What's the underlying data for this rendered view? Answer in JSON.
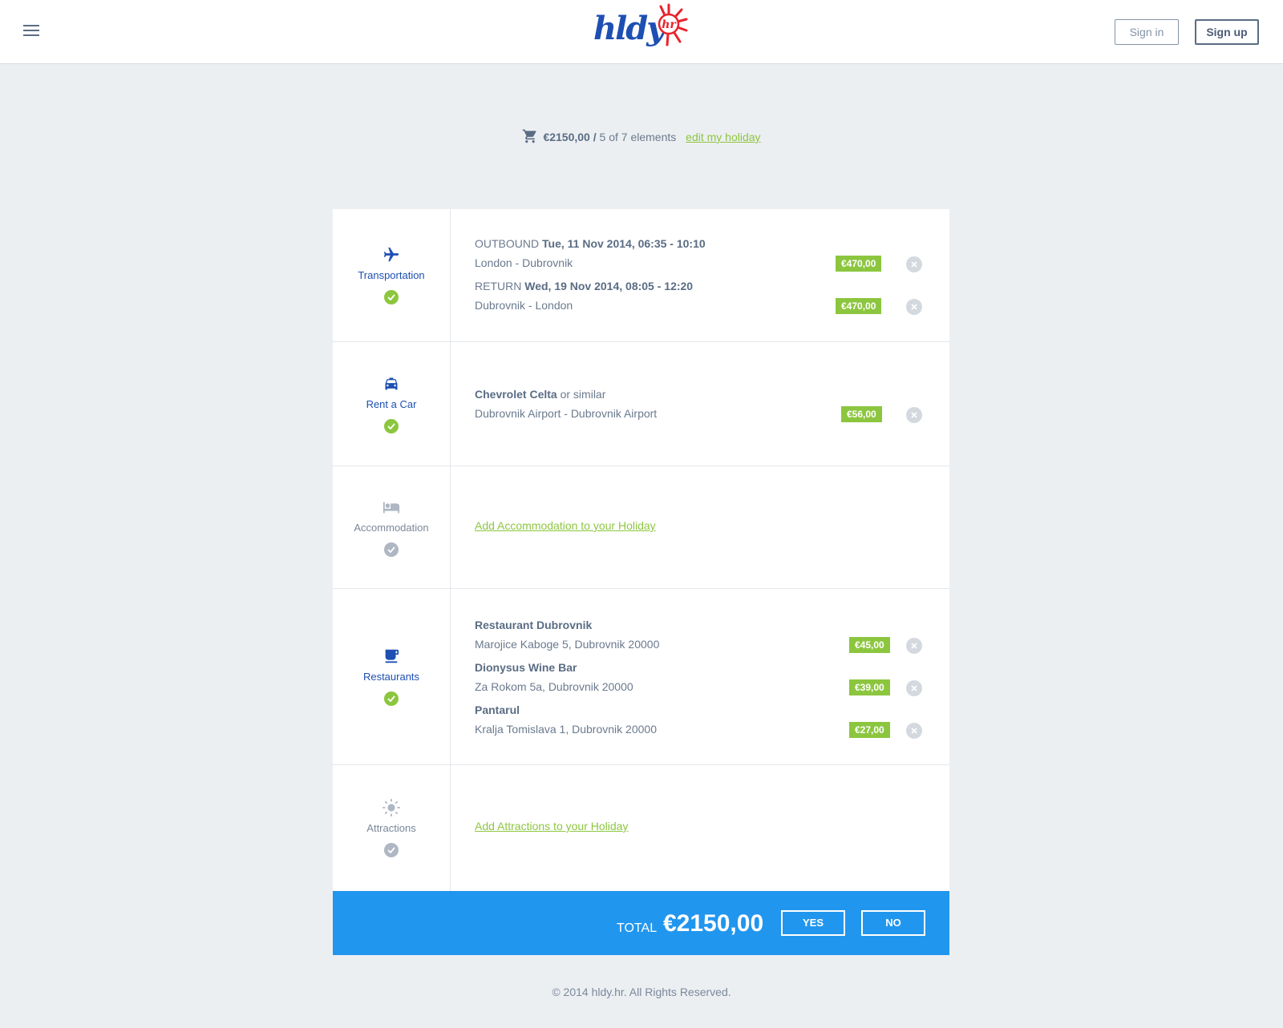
{
  "header": {
    "logo_text": "hldy",
    "logo_badge": "hr",
    "signin_label": "Sign in",
    "signup_label": "Sign up"
  },
  "cart": {
    "amount": "€2150,00",
    "separator": " / ",
    "elements": "5 of 7 elements",
    "edit_label": "edit my holiday"
  },
  "transportation": {
    "label": "Transportation",
    "outbound_prefix": "OUTBOUND",
    "outbound_date": "Tue, 11 Nov 2014, 06:35 - 10:10",
    "outbound_route": "London - Dubrovnik",
    "outbound_price": "€470,00",
    "return_prefix": "RETURN",
    "return_date": "Wed, 19 Nov 2014, 08:05 - 12:20",
    "return_route": "Dubrovnik - London",
    "return_price": "€470,00"
  },
  "car": {
    "label": "Rent a Car",
    "model": "Chevrolet Celta",
    "model_suffix": " or similar",
    "route": "Dubrovnik Airport - Dubrovnik Airport",
    "price": "€56,00"
  },
  "accommodation": {
    "label": "Accommodation",
    "add_label": "Add Accommodation to your Holiday"
  },
  "restaurants": {
    "label": "Restaurants",
    "items": [
      {
        "name": "Restaurant Dubrovnik",
        "address": "Marojice Kaboge 5, Dubrovnik 20000",
        "price": "€45,00"
      },
      {
        "name": "Dionysus Wine Bar",
        "address": "Za Rokom 5a, Dubrovnik 20000",
        "price": "€39,00"
      },
      {
        "name": "Pantarul",
        "address": "Kralja Tomislava 1, Dubrovnik 20000",
        "price": "€27,00"
      }
    ]
  },
  "attractions": {
    "label": "Attractions",
    "add_label": "Add Attractions to your Holiday"
  },
  "total": {
    "label": "TOTAL",
    "value": "€2150,00",
    "yes_label": "YES",
    "no_label": "NO"
  },
  "footer": {
    "copyright": "© 2014 hldy.hr. All Rights Reserved."
  },
  "colors": {
    "brand_blue": "#1e4fb2",
    "accent_green": "#8cc63f",
    "total_bar": "#2196ee",
    "logo_sun": "#e8232c"
  }
}
